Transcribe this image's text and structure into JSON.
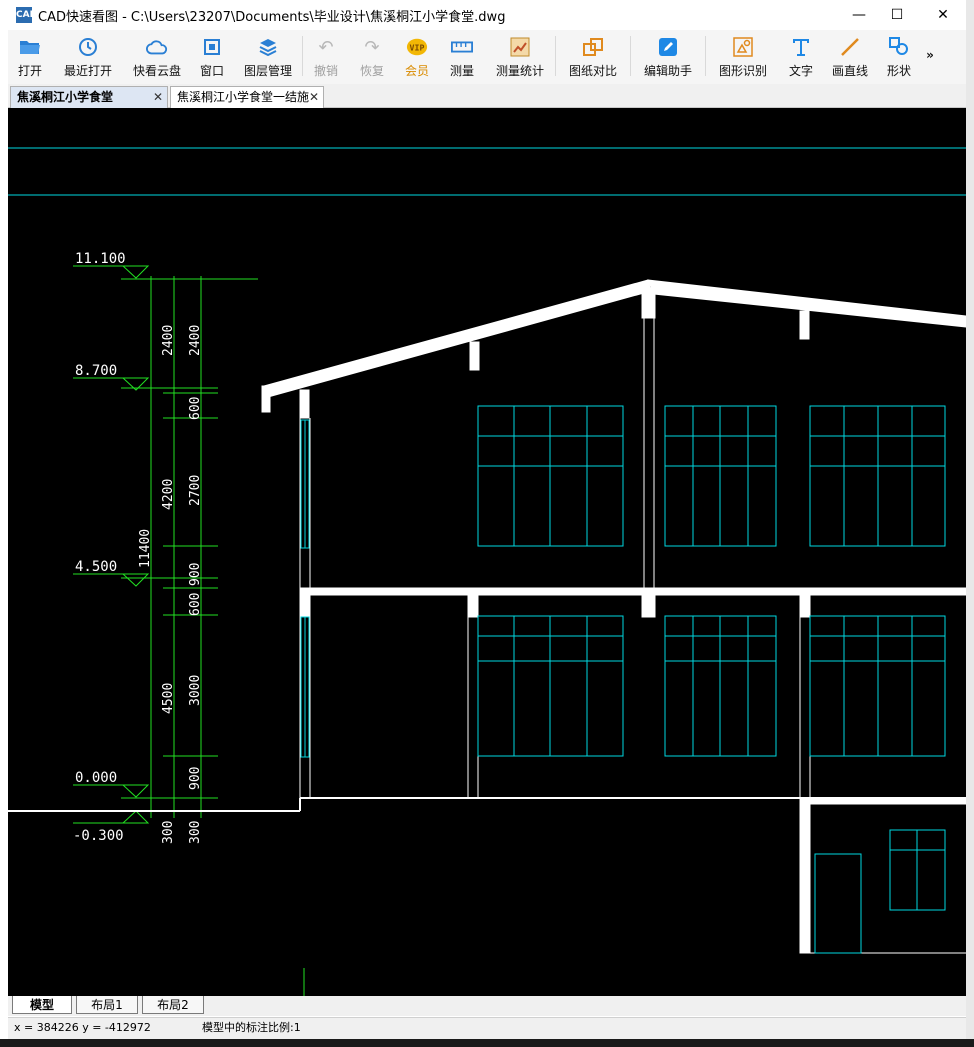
{
  "window": {
    "app_badge": "CAD",
    "title": "CAD快速看图 - C:\\Users\\23207\\Documents\\毕业设计\\焦溪桐江小学食堂.dwg",
    "minimize": "—",
    "maximize": "☐",
    "close": "✕"
  },
  "toolbar": {
    "open": "打开",
    "recent": "最近打开",
    "cloud": "快看云盘",
    "window": "窗口",
    "layers": "图层管理",
    "undo": "撤销",
    "redo": "恢复",
    "vip": "会员",
    "measure": "测量",
    "measure_stats": "测量统计",
    "compare": "图纸对比",
    "edit_assistant": "编辑助手",
    "shape_recognize": "图形识别",
    "text": "文字",
    "line": "画直线",
    "shape": "形状",
    "more": "»"
  },
  "tabs": [
    {
      "label": "焦溪桐江小学食堂",
      "close": "✕"
    },
    {
      "label": "焦溪桐江小学食堂一结施",
      "close": "✕"
    }
  ],
  "drawing": {
    "elevations": [
      "11.100",
      "8.700",
      "4.500",
      "0.000",
      "-0.300"
    ],
    "dim_outer": [
      "2400",
      "4200",
      "4500",
      "300"
    ],
    "dim_total": "11400",
    "dim_inner": [
      "2400",
      "600",
      "2700",
      "900",
      "600",
      "3000",
      "900",
      "300"
    ]
  },
  "layout_tabs": [
    "模型",
    "布局1",
    "布局2"
  ],
  "status": {
    "coords": "x = 384226  y = -412972",
    "scale": "模型中的标注比例:1"
  }
}
